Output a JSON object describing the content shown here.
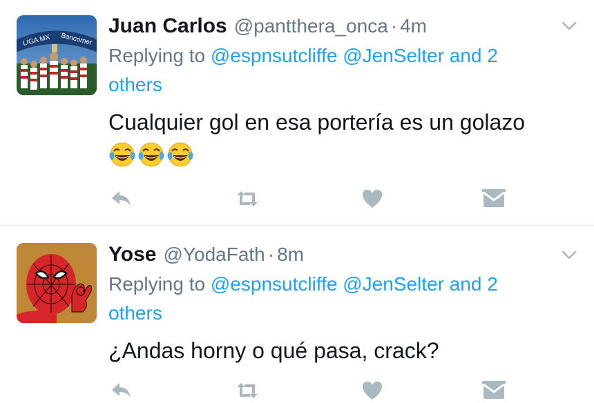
{
  "colors": {
    "name": "#14171a",
    "secondary": "#657786",
    "mention": "#1da1f2",
    "icon": "#aab8c2",
    "divider": "#e1e8ed"
  },
  "tweets": [
    {
      "display_name": "Juan Carlos",
      "handle": "@pantthera_onca",
      "separator": "·",
      "time": "4m",
      "replying_prefix": "Replying to",
      "mention_1": "@espnsutcliffe",
      "mention_2": "@JenSelter",
      "and_more": "and 2 others",
      "text": "Cualquier gol en esa portería es un golazo",
      "emoji_count": 3,
      "emoji_icon": "face-with-tears-of-joy-icon",
      "avatar_text": "LIGA MX Bancomer"
    },
    {
      "display_name": "Yose",
      "handle": "@YodaFath",
      "separator": "·",
      "time": "8m",
      "replying_prefix": "Replying to",
      "mention_1": "@espnsutcliffe",
      "mention_2": "@JenSelter",
      "and_more": "and 2 others",
      "text": "¿Andas horny o qué pasa, crack?"
    }
  ],
  "action_icons": [
    "reply-icon",
    "retweet-icon",
    "like-icon",
    "direct-message-icon"
  ]
}
